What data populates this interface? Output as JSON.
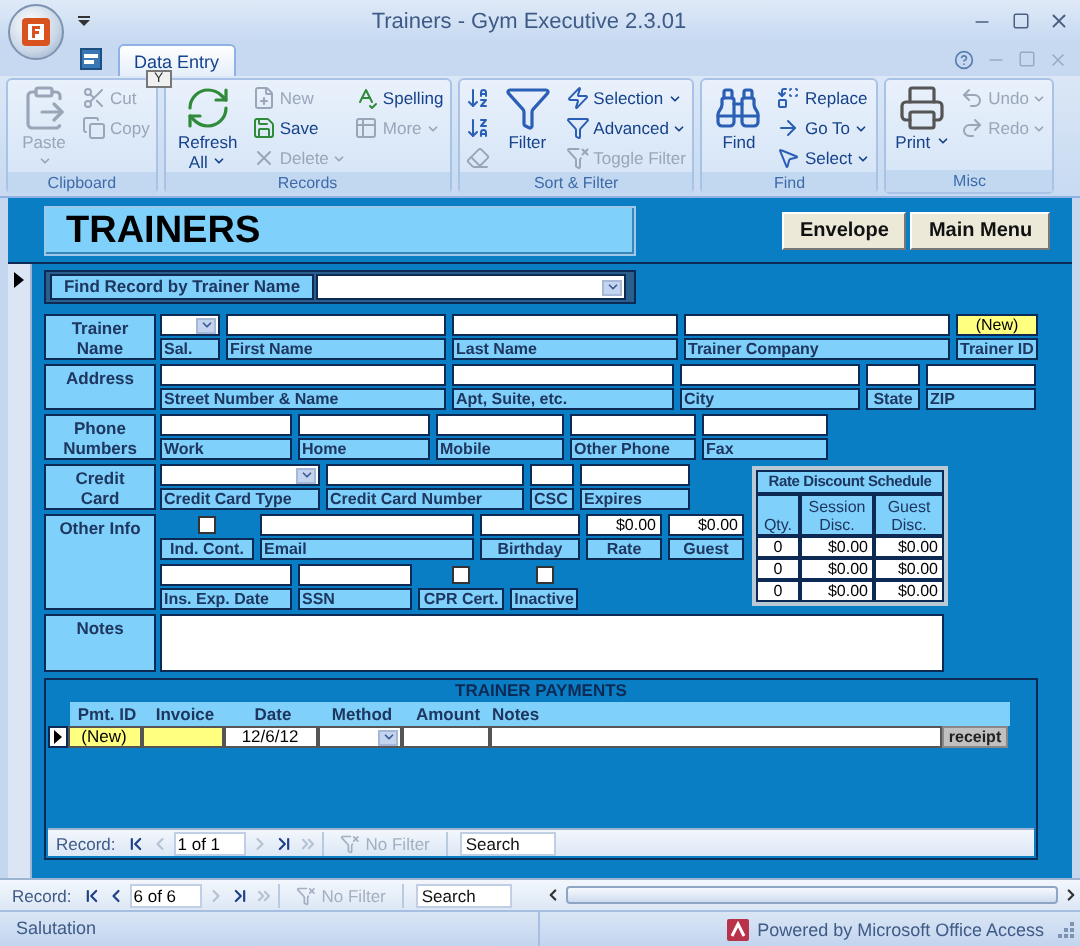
{
  "window": {
    "title": "Trainers - Gym Executive 2.3.01"
  },
  "ribbon": {
    "tabs": [
      {
        "label": "Data Entry",
        "selected": true,
        "key_tip": "Y"
      }
    ],
    "groups": [
      {
        "label": "Clipboard",
        "columns": [
          [
            {
              "label": "Paste",
              "kind": "large",
              "disabled": true,
              "dropdown": true
            }
          ],
          [
            {
              "label": "Cut",
              "kind": "small",
              "disabled": true,
              "dropdown": false
            },
            {
              "label": "Copy",
              "kind": "small",
              "disabled": true,
              "dropdown": false
            }
          ]
        ]
      },
      {
        "label": "Records",
        "columns": [
          [
            {
              "label": "Refresh All",
              "kind": "large",
              "disabled": false,
              "dropdown": true
            }
          ],
          [
            {
              "label": "New",
              "kind": "small",
              "disabled": true,
              "dropdown": false
            },
            {
              "label": "Save",
              "kind": "small",
              "disabled": false,
              "dropdown": false
            },
            {
              "label": "Delete",
              "kind": "small",
              "disabled": true,
              "dropdown": true
            }
          ],
          [
            {
              "label": "Spelling",
              "kind": "small",
              "disabled": false,
              "dropdown": false
            },
            {
              "label": "More",
              "kind": "small",
              "disabled": true,
              "dropdown": true
            }
          ]
        ]
      },
      {
        "label": "Sort & Filter",
        "columns": [
          [
            {
              "kind": "small",
              "disabled": false,
              "dropdown": false
            },
            {
              "kind": "small",
              "disabled": false,
              "dropdown": false
            },
            {
              "kind": "small",
              "disabled": true,
              "dropdown": false
            }
          ],
          [
            {
              "label": "Filter",
              "kind": "large",
              "disabled": false,
              "dropdown": false
            }
          ],
          [
            {
              "label": "Selection",
              "kind": "small",
              "disabled": false,
              "dropdown": true
            },
            {
              "label": "Advanced",
              "kind": "small",
              "disabled": false,
              "dropdown": true
            },
            {
              "label": "Toggle Filter",
              "kind": "small",
              "disabled": true,
              "dropdown": false
            }
          ]
        ]
      },
      {
        "label": "Find",
        "columns": [
          [
            {
              "label": "Find",
              "kind": "large",
              "disabled": false,
              "dropdown": false
            }
          ],
          [
            {
              "label": "Replace",
              "kind": "small",
              "disabled": false,
              "dropdown": false
            },
            {
              "label": "Go To",
              "kind": "small",
              "disabled": false,
              "dropdown": true
            },
            {
              "label": "Select",
              "kind": "small",
              "disabled": false,
              "dropdown": true
            }
          ]
        ]
      },
      {
        "label": "Misc",
        "columns": [
          [
            {
              "label": "Print",
              "kind": "large",
              "disabled": false,
              "dropdown": true
            }
          ],
          [
            {
              "label": "Undo",
              "kind": "small",
              "disabled": true,
              "dropdown": true
            },
            {
              "label": "Redo",
              "kind": "small",
              "disabled": true,
              "dropdown": true
            }
          ]
        ]
      }
    ]
  },
  "form": {
    "title": "TRAINERS",
    "buttons": [
      "Envelope",
      "Main Menu"
    ],
    "find": {
      "label": "Find Record by Trainer Name"
    },
    "sections": [
      {
        "label": "Trainer Name",
        "lines": [
          {
            "fields": [
              {
                "caption": "Sal.",
                "kind": "combo"
              },
              {
                "caption": "First Name",
                "kind": "text"
              },
              {
                "caption": "Last Name",
                "kind": "text"
              },
              {
                "caption": "Trainer Company",
                "kind": "text"
              },
              {
                "caption": "Trainer ID",
                "kind": "id",
                "value": "(New)"
              }
            ]
          }
        ]
      },
      {
        "label": "Address",
        "lines": [
          {
            "fields": [
              {
                "caption": "Street Number & Name",
                "kind": "text"
              },
              {
                "caption": "Apt, Suite, etc.",
                "kind": "text"
              },
              {
                "caption": "City",
                "kind": "text"
              },
              {
                "caption": "State",
                "kind": "text"
              },
              {
                "caption": "ZIP",
                "kind": "text"
              }
            ]
          }
        ]
      },
      {
        "label": "Phone Numbers",
        "lines": [
          {
            "fields": [
              {
                "caption": "Work",
                "kind": "text"
              },
              {
                "caption": "Home",
                "kind": "text"
              },
              {
                "caption": "Mobile",
                "kind": "text"
              },
              {
                "caption": "Other Phone",
                "kind": "text"
              },
              {
                "caption": "Fax",
                "kind": "text"
              }
            ]
          }
        ]
      },
      {
        "label": "Credit Card",
        "lines": [
          {
            "fields": [
              {
                "caption": "Credit Card Type",
                "kind": "combo"
              },
              {
                "caption": "Credit Card Number",
                "kind": "text"
              },
              {
                "caption": "CSC",
                "kind": "text"
              },
              {
                "caption": "Expires",
                "kind": "text"
              }
            ]
          }
        ]
      },
      {
        "label": "Other Info",
        "lines": [
          {
            "fields": [
              {
                "caption": "Ind. Cont.",
                "kind": "checkbox",
                "checked": false
              },
              {
                "caption": "Email",
                "kind": "text"
              },
              {
                "caption": "Birthday",
                "kind": "text"
              },
              {
                "caption": "Rate",
                "kind": "currency",
                "value": "$0.00"
              },
              {
                "caption": "Guest",
                "kind": "currency",
                "value": "$0.00"
              }
            ]
          },
          {
            "fields": [
              {
                "caption": "Ins. Exp. Date",
                "kind": "text"
              },
              {
                "caption": "SSN",
                "kind": "text"
              },
              {
                "caption": "CPR Cert.",
                "kind": "checkbox",
                "checked": false
              },
              {
                "caption": "Inactive",
                "kind": "checkbox",
                "checked": false
              }
            ]
          }
        ]
      },
      {
        "label": "Notes",
        "lines": [
          {
            "fields": [
              {
                "kind": "memo"
              }
            ]
          }
        ]
      }
    ],
    "rate_schedule": {
      "title": "Rate Discount Schedule",
      "columns": [
        "Qty.",
        "Session Disc.",
        "Guest Disc."
      ],
      "rows": [
        [
          "0",
          "$0.00",
          "$0.00"
        ],
        [
          "0",
          "$0.00",
          "$0.00"
        ],
        [
          "0",
          "$0.00",
          "$0.00"
        ]
      ]
    },
    "payments": {
      "title": "TRAINER PAYMENTS",
      "columns": [
        "Pmt. ID",
        "Invoice",
        "Date",
        "Method",
        "Amount",
        "Notes"
      ],
      "rows": [
        {
          "current": true,
          "pmt_id": "(New)",
          "date": "12/6/12",
          "button": "receipt"
        }
      ],
      "navigation": {
        "label": "Record:",
        "position": "1 of 1",
        "buttons": [
          {
            "kind": "first",
            "disabled": false
          },
          {
            "kind": "previous",
            "disabled": true
          },
          {
            "kind": "next",
            "disabled": true
          },
          {
            "kind": "last",
            "disabled": false
          },
          {
            "kind": "new",
            "disabled": true
          }
        ],
        "filter": {
          "label": "No Filter",
          "disabled": true
        },
        "search": {
          "placeholder": "Search"
        }
      }
    }
  },
  "navigation": {
    "label": "Record:",
    "position": "6 of 6",
    "buttons": [
      {
        "kind": "first",
        "disabled": false
      },
      {
        "kind": "previous",
        "disabled": false
      },
      {
        "kind": "next",
        "disabled": true
      },
      {
        "kind": "last",
        "disabled": false
      },
      {
        "kind": "new",
        "disabled": true
      }
    ],
    "filter": {
      "label": "No Filter",
      "disabled": true
    },
    "search": {
      "placeholder": "Search"
    }
  },
  "status_bar": {
    "text": "Salutation",
    "branding": "Powered by Microsoft Office Access"
  }
}
